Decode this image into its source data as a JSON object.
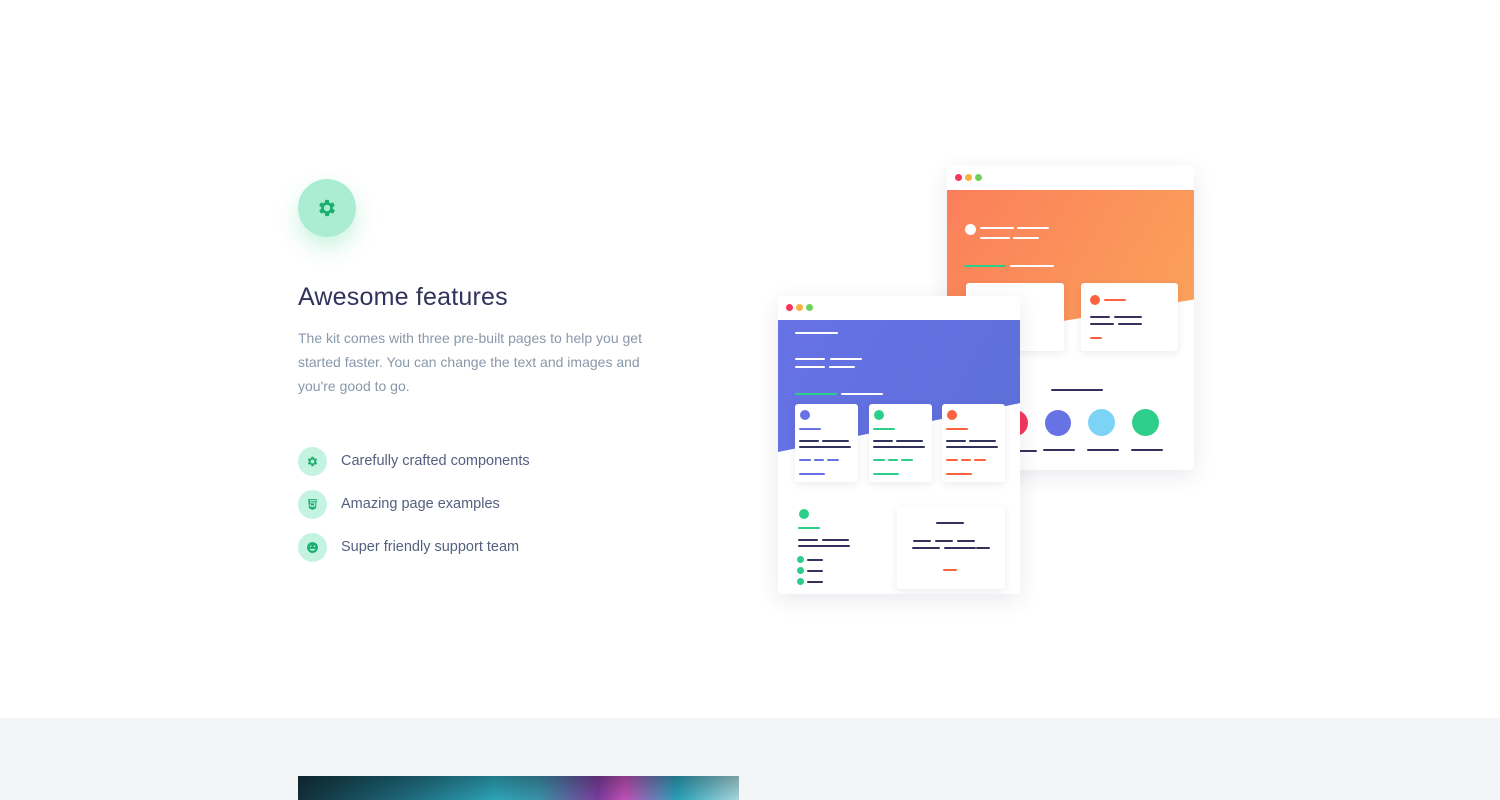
{
  "feature": {
    "icon": "gear-icon",
    "title": "Awesome features",
    "description": "The kit comes with three pre-built pages to help you get started faster. You can change the text and images and you're good to go.",
    "items": [
      {
        "icon": "gear-icon",
        "label": "Carefully crafted components"
      },
      {
        "icon": "html5-icon",
        "label": "Amazing page examples"
      },
      {
        "icon": "smile-icon",
        "label": "Super friendly support team"
      }
    ]
  },
  "colors": {
    "accent": "#2dce89",
    "icon_bg": "#aaedd3",
    "list_icon_bg": "#c5f3e1",
    "title": "#32325d",
    "text": "#8898aa",
    "orange": "#fb8c59",
    "indigo": "#6772e5",
    "red": "#f5365c",
    "sky": "#7dd3f5",
    "section_bg": "#f4f5f7"
  },
  "illustration": {
    "name": "page-examples-illustration"
  }
}
